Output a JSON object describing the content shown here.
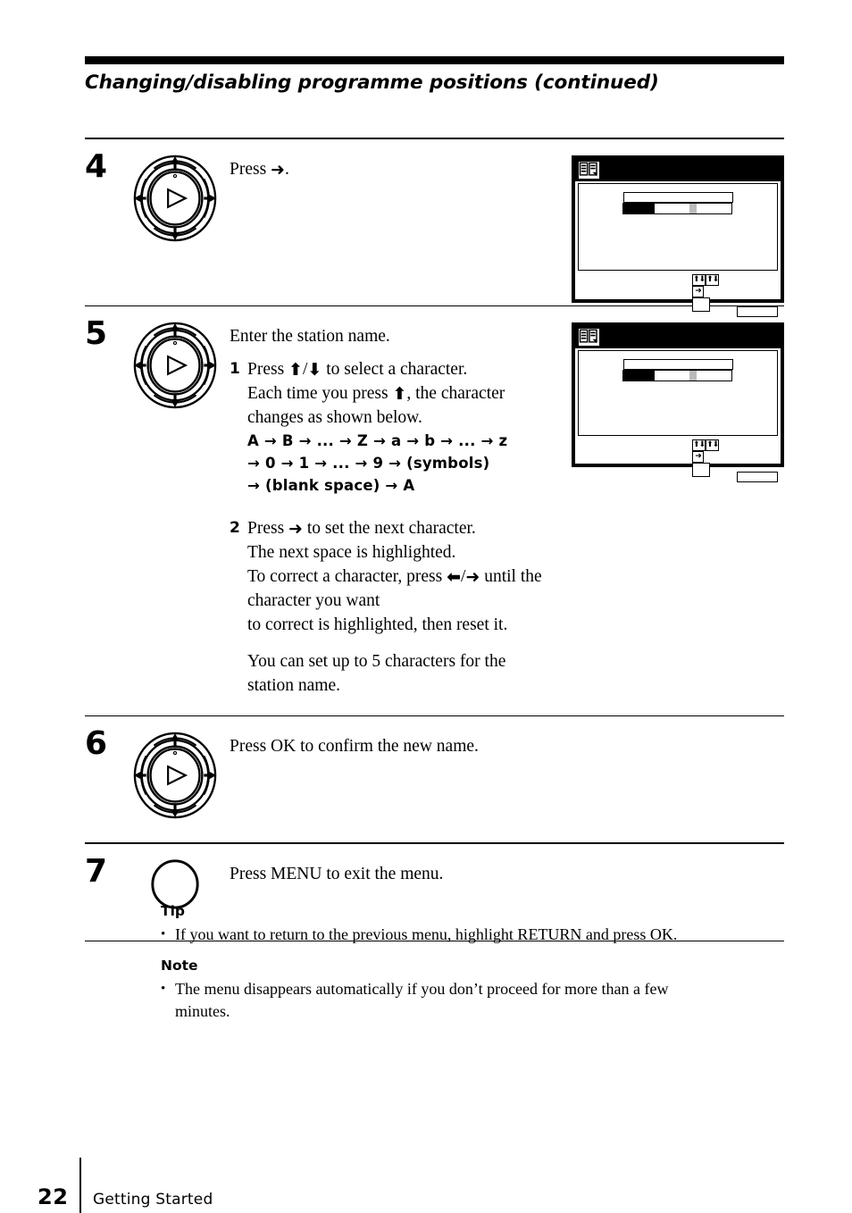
{
  "page": {
    "title": "Changing/disabling programme positions (continued)",
    "folio": "22",
    "section": "Getting Started"
  },
  "glyphs": {
    "right_arrow": "➜",
    "left_arrow": "⬅",
    "up_arrow": "⬆",
    "down_arrow": "⬇",
    "seq_arrow": "→",
    "bullet": "•",
    "play_triangle": "▷"
  },
  "steps": [
    {
      "number": "4",
      "control": "dpad-control",
      "lead_before": "Press ",
      "lead_after": ".",
      "osd": true
    },
    {
      "number": "5",
      "control": "dpad-control",
      "lead": "Enter the station name.",
      "substeps": [
        {
          "num": "1",
          "line1_a": "Press ",
          "line1_b": "/",
          "line1_c": " to select a character.",
          "line2_a": "Each time you press ",
          "line2_b": ", the character",
          "line3": "changes as shown below.",
          "sequence_line1": "A → B → ... → Z → a → b → ... → z",
          "sequence_line2": "→ 0 → 1 → ... → 9 → (symbols)",
          "sequence_line3": "→   (blank space) → A"
        },
        {
          "num": "2",
          "line1_a": "Press ",
          "line1_b": " to set the next character.",
          "line2": "The next space is highlighted.",
          "line3_a": "To correct a character, press ",
          "line3_b": "/",
          "line3_c": " until the character you want",
          "line4": "to correct is highlighted, then reset it."
        }
      ],
      "closing": "You can set up to 5 characters for the station name.",
      "osd": true
    },
    {
      "number": "6",
      "control": "dpad-control",
      "lead": "Press OK to confirm the new name.",
      "osd": false
    },
    {
      "number": "7",
      "control": "menu-button",
      "lead": "Press MENU to exit the menu.",
      "osd": false
    }
  ],
  "osd_screen": {
    "icon_name": "programme-list-icon",
    "nav_cells": [
      "⬆⬇",
      "➜",
      ""
    ],
    "return_label": ""
  },
  "tip": {
    "heading": "Tip",
    "bullet": "If you want to return to the previous menu, highlight RETURN and press OK."
  },
  "note": {
    "heading": "Note",
    "bullet_line1": "The menu disappears automatically if you don’t proceed for more than a few",
    "bullet_line2": "minutes."
  }
}
